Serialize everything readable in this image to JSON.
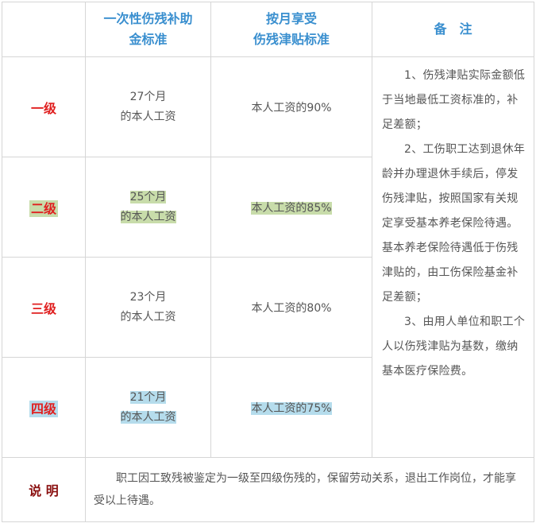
{
  "header": {
    "col2_line1": "一次性伤残补助",
    "col2_line2": "金标准",
    "col3_line1": "按月享受",
    "col3_line2": "伤残津贴标准",
    "col4": "备　注"
  },
  "colors": {
    "level_red": "#e02020",
    "header_blue": "#3a8fcf",
    "highlight_green": "#c8dcaa",
    "highlight_blue": "#b5dcec"
  },
  "rows": [
    {
      "level": "一级",
      "months": "27个月",
      "wage": "的本人工资",
      "allowance": "本人工资的90%"
    },
    {
      "level": "二级",
      "months": "25个月",
      "wage": "的本人工资",
      "allowance": "本人工资的85%"
    },
    {
      "level": "三级",
      "months": "23个月",
      "wage": "的本人工资",
      "allowance": "本人工资的80%"
    },
    {
      "level": "四级",
      "months": "21个月",
      "wage": "的本人工资",
      "allowance": "本人工资的75%"
    }
  ],
  "notes": [
    "1、伤残津贴实际金额低于当地最低工资标准的，补足差额；",
    "2、工伤职工达到退休年龄并办理退休手续后，停发伤残津贴，按照国家有关规定享受基本养老保险待遇。基本养老保险待遇低于伤残津贴的，由工伤保险基金补足差额；",
    "3、由用人单位和职工个人以伤残津贴为基数，缴纳基本医疗保险费。"
  ],
  "footer": {
    "label": "说 明",
    "text": "职工因工致残被鉴定为一级至四级伤残的，保留劳动关系，退出工作岗位，才能享受以上待遇。"
  }
}
